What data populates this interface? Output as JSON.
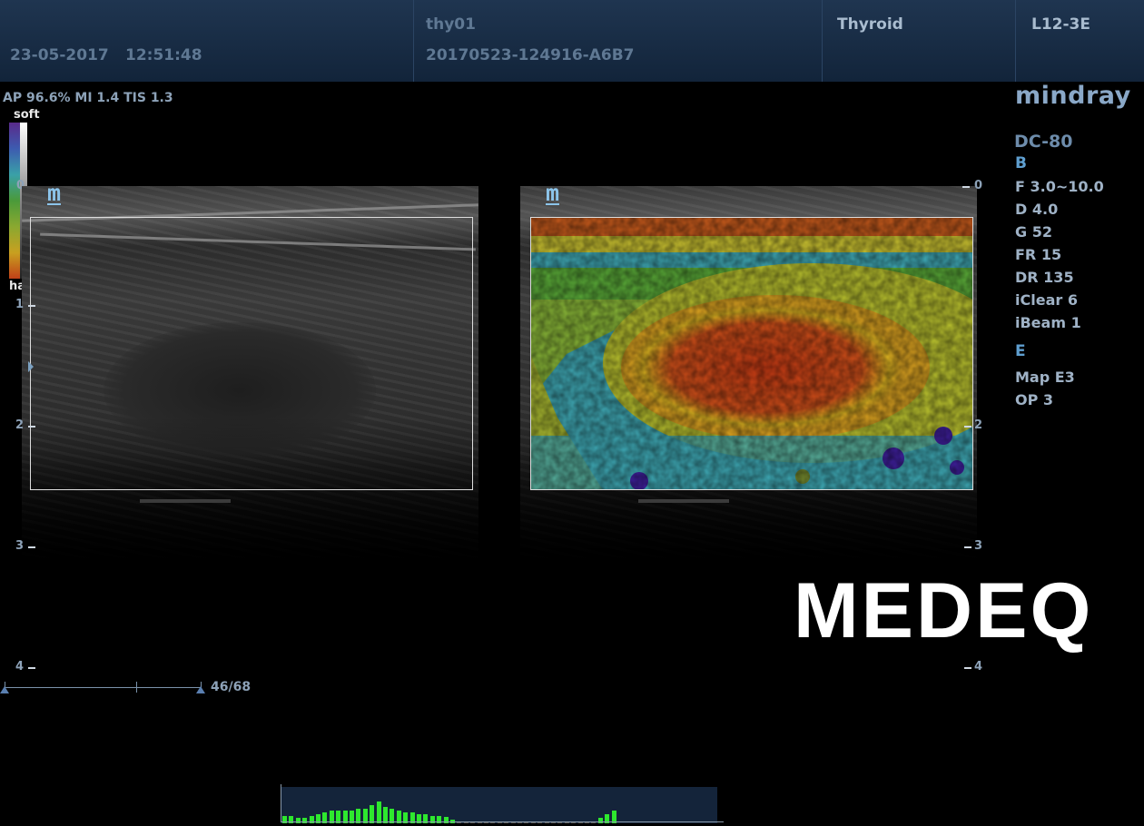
{
  "header": {
    "date": "23-05-2017",
    "time": "12:51:48",
    "patient_id": "thy01",
    "exam_id": "20170523-124916-A6B7",
    "exam_type": "Thyroid",
    "probe": "L12-3E"
  },
  "acoustic_params": "AP 96.6%  MI 1.4  TIS 1.3",
  "colorbar": {
    "top_label": "soft",
    "bottom_label": "hard",
    "zero_label": "0"
  },
  "brand": "mindray",
  "model": "DC-80",
  "settings": {
    "b_mode": {
      "label": "B",
      "items": [
        "F 3.0~10.0",
        "D 4.0",
        "G 52",
        "FR 15",
        "DR 135",
        "iClear 6",
        "iBeam 1"
      ]
    },
    "e_mode": {
      "label": "E",
      "items": [
        "Map E3",
        "OP 3"
      ]
    }
  },
  "depth_scale": {
    "left": [
      "1",
      "2",
      "3",
      "4"
    ],
    "right": [
      "0",
      "2",
      "3",
      "4"
    ]
  },
  "probe_marker": "m",
  "frame_counter": "46/68",
  "watermark": "MEDEQ",
  "cine_bars": [
    0.2,
    0.2,
    0.15,
    0.15,
    0.2,
    0.25,
    0.3,
    0.35,
    0.35,
    0.35,
    0.35,
    0.4,
    0.4,
    0.5,
    0.6,
    0.45,
    0.4,
    0.35,
    0.3,
    0.3,
    0.25,
    0.25,
    0.2,
    0.2,
    0.18,
    0.1,
    0.05,
    0.05,
    0.05,
    0.05,
    0.05,
    0.05,
    0.05,
    0.05,
    0.05,
    0.05,
    0.05,
    0.05,
    0.05,
    0.05,
    0.05,
    0.05,
    0.05,
    0.05,
    0.05,
    0.05,
    0.05,
    0.15,
    0.25,
    0.35
  ],
  "colors": {
    "accent": "#8cc4ea",
    "cine_active": "#2ee82e",
    "header_bg": "#1a2e47"
  }
}
